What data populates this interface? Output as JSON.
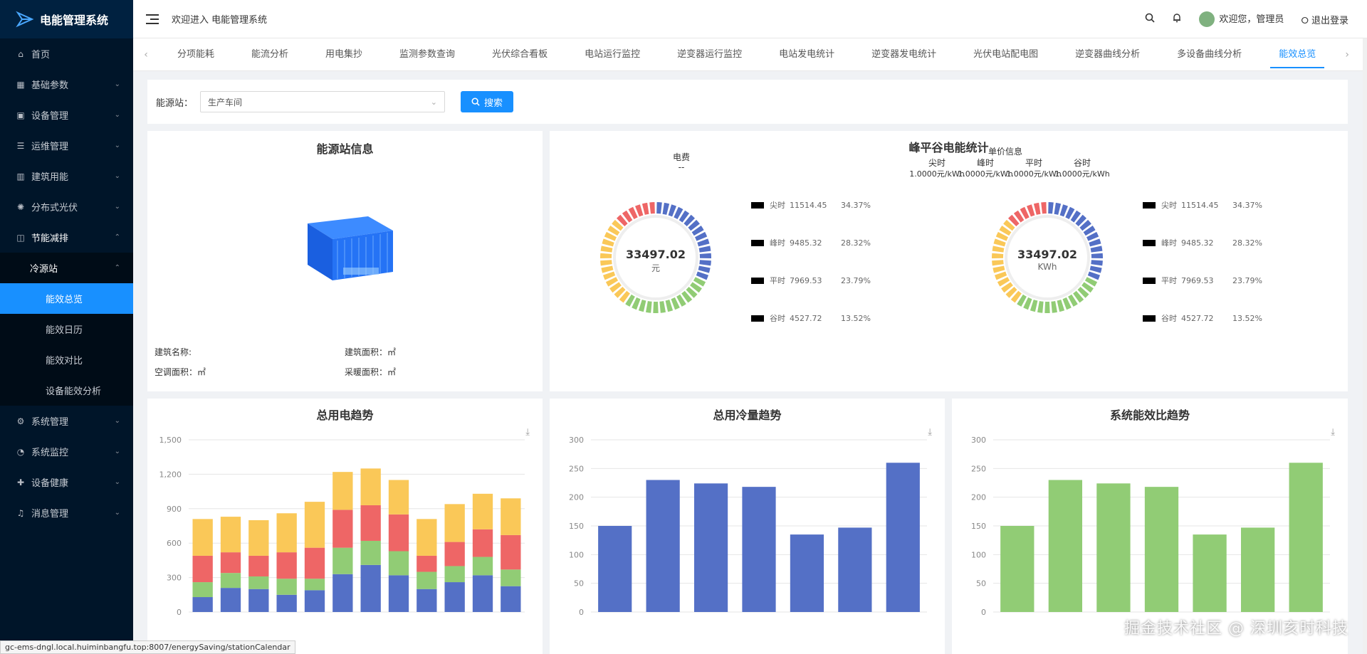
{
  "app": {
    "title": "电能管理系统"
  },
  "sidebar": {
    "items": [
      {
        "label": "首页",
        "icon": "home-icon",
        "arrow": ""
      },
      {
        "label": "基础参数",
        "icon": "grid-icon",
        "arrow": "⌄"
      },
      {
        "label": "设备管理",
        "icon": "device-icon",
        "arrow": "⌄"
      },
      {
        "label": "运维管理",
        "icon": "list-icon",
        "arrow": "⌄"
      },
      {
        "label": "建筑用能",
        "icon": "building-icon",
        "arrow": "⌄"
      },
      {
        "label": "分布式光伏",
        "icon": "solar-icon",
        "arrow": "⌄"
      },
      {
        "label": "节能减排",
        "icon": "leaf-icon",
        "arrow": "⌃"
      }
    ],
    "sub_group": {
      "label": "冷源站",
      "arrow": "⌃"
    },
    "sub_items": [
      "能效总览",
      "能效日历",
      "能效对比",
      "设备能效分析"
    ],
    "items_after": [
      {
        "label": "系统管理",
        "icon": "settings-icon",
        "arrow": "⌄"
      },
      {
        "label": "系统监控",
        "icon": "monitor-icon",
        "arrow": "⌄"
      },
      {
        "label": "设备健康",
        "icon": "health-icon",
        "arrow": "⌄"
      },
      {
        "label": "消息管理",
        "icon": "bell-icon",
        "arrow": "⌄"
      }
    ]
  },
  "header": {
    "welcome": "欢迎进入 电能管理系统",
    "greeting": "欢迎您，管理员",
    "logout": "退出登录"
  },
  "tabs": [
    "分项能耗",
    "能流分析",
    "用电集抄",
    "监测参数查询",
    "光伏综合看板",
    "电站运行监控",
    "逆变器运行监控",
    "电站发电统计",
    "逆变器发电统计",
    "光伏电站配电图",
    "逆变器曲线分析",
    "多设备曲线分析",
    "能效总览"
  ],
  "search": {
    "label": "能源站：",
    "value": "生产车间",
    "button": "搜索"
  },
  "station": {
    "title": "能源站信息",
    "building_name": "建筑名称:",
    "building_area": "建筑面积：㎡",
    "ac_area": "空调面积：㎡",
    "heating_area": "采暖面积：㎡"
  },
  "peak": {
    "title": "峰平谷电能统计",
    "fee_label": "电费",
    "fee_value": "--",
    "unit_price_label": "单价信息",
    "price_headers": [
      "尖时",
      "峰时",
      "平时",
      "谷时"
    ],
    "prices": [
      "1.0000元/kWh",
      "1.0000元/kWh",
      "1.0000元/kWh",
      "1.0000元/kWh"
    ],
    "donuts": [
      {
        "value": "33497.02",
        "unit": "元"
      },
      {
        "value": "33497.02",
        "unit": "KWh"
      }
    ],
    "legend": [
      {
        "name": "尖时",
        "value": "11514.45",
        "pct": "34.37%",
        "color": "#5470c6"
      },
      {
        "name": "峰时",
        "value": "9485.32",
        "pct": "28.32%",
        "color": "#91cc75"
      },
      {
        "name": "平时",
        "value": "7969.53",
        "pct": "23.79%",
        "color": "#fac858"
      },
      {
        "name": "谷时",
        "value": "4527.72",
        "pct": "13.52%",
        "color": "#ee6666"
      }
    ]
  },
  "chart_data": [
    {
      "type": "bar",
      "title": "总用电趋势",
      "ylim": [
        0,
        1500
      ],
      "yticks": [
        "0",
        "300",
        "600",
        "900",
        "1,200",
        "1,500"
      ],
      "stacked": true,
      "colors": [
        "#5470c6",
        "#91cc75",
        "#ee6666",
        "#fac858"
      ],
      "series": [
        {
          "values": [
            130,
            210,
            200,
            150,
            190,
            330,
            410,
            320,
            200,
            260,
            320,
            225
          ]
        },
        {
          "values": [
            130,
            130,
            110,
            140,
            100,
            230,
            210,
            210,
            150,
            140,
            160,
            145
          ]
        },
        {
          "values": [
            230,
            180,
            180,
            230,
            270,
            330,
            310,
            320,
            140,
            210,
            240,
            300
          ]
        },
        {
          "values": [
            320,
            310,
            310,
            340,
            400,
            330,
            320,
            300,
            320,
            330,
            310,
            320
          ]
        }
      ]
    },
    {
      "type": "bar",
      "title": "总用冷量趋势",
      "ylim": [
        0,
        300
      ],
      "yticks": [
        "0",
        "50",
        "100",
        "150",
        "200",
        "250",
        "300"
      ],
      "color": "#5470c6",
      "values": [
        150,
        230,
        224,
        218,
        135,
        147,
        260
      ]
    },
    {
      "type": "bar",
      "title": "系统能效比趋势",
      "ylim": [
        0,
        300
      ],
      "yticks": [
        "0",
        "50",
        "100",
        "150",
        "200",
        "250",
        "300"
      ],
      "color": "#91cc75",
      "values": [
        150,
        230,
        224,
        218,
        135,
        147,
        260
      ]
    }
  ],
  "status_url": "gc-ems-dngl.local.huiminbangfu.top:8007/energySaving/stationCalendar",
  "watermark": "掘金技术社区 @ 深圳亥时科技"
}
